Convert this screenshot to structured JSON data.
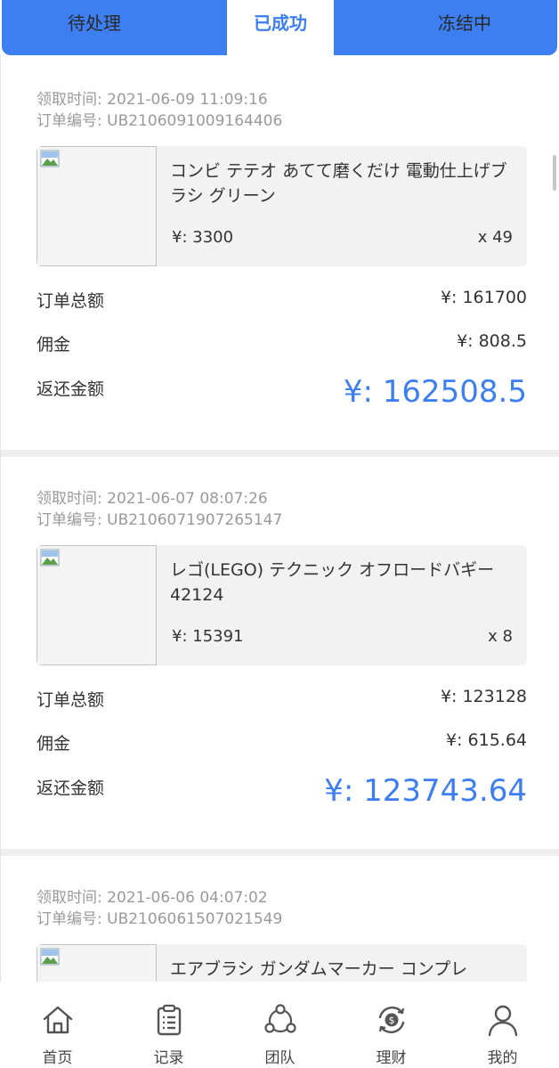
{
  "tabs": [
    {
      "label": "待处理"
    },
    {
      "label": "已成功"
    },
    {
      "label": "冻结中"
    }
  ],
  "meta_labels": {
    "time": "领取时间:",
    "order": "订单编号:"
  },
  "row_labels": {
    "total": "订单总额",
    "commission": "佣金",
    "refund": "返还金额"
  },
  "orders": [
    {
      "time": "2021-06-09 11:09:16",
      "order_no": "UB2106091009164406",
      "product_name": "コンビ テテオ あてて磨くだけ 電動仕上げブラシ グリーン",
      "price": "¥: 3300",
      "qty": "x 49",
      "total": "¥: 161700",
      "commission": "¥: 808.5",
      "refund": "¥: 162508.5"
    },
    {
      "time": "2021-06-07 08:07:26",
      "order_no": "UB2106071907265147",
      "product_name": "レゴ(LEGO) テクニック オフロードバギー 42124",
      "price": "¥: 15391",
      "qty": "x 8",
      "total": "¥: 123128",
      "commission": "¥: 615.64",
      "refund": "¥: 123743.64"
    },
    {
      "time": "2021-06-06 04:07:02",
      "order_no": "UB2106061507021549",
      "product_name": "エアブラシ ガンダムマーカー コンプレ"
    }
  ],
  "nav": [
    {
      "label": "首页",
      "icon": "home-icon"
    },
    {
      "label": "记录",
      "icon": "clipboard-icon"
    },
    {
      "label": "团队",
      "icon": "team-icon"
    },
    {
      "label": "理财",
      "icon": "finance-icon"
    },
    {
      "label": "我的",
      "icon": "user-icon"
    }
  ],
  "colors": {
    "accent": "#3d7ef0",
    "tab_bar": "#3d7ef0",
    "meta_text": "#9a9a9a"
  }
}
